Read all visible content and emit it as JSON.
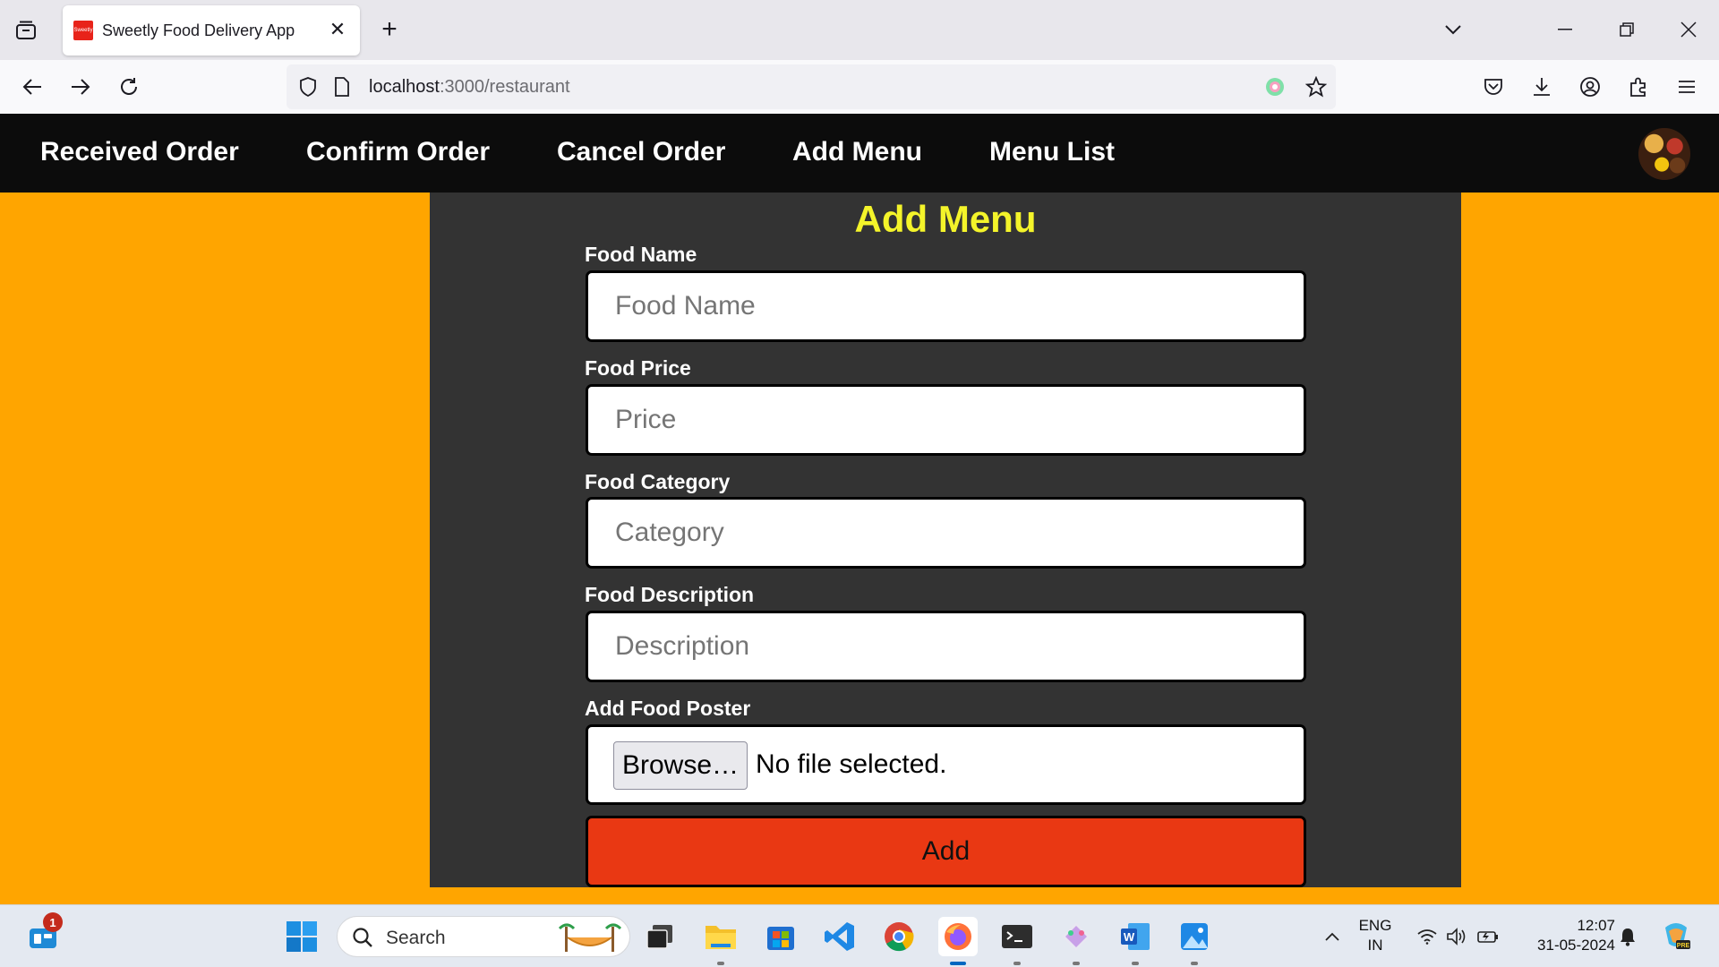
{
  "browser": {
    "tab_title": "Sweetly Food Delivery App",
    "favicon_text": "Sweetly",
    "url_host": "localhost",
    "url_path": ":3000/restaurant"
  },
  "app_nav": {
    "links": [
      "Received Order",
      "Confirm Order",
      "Cancel Order",
      "Add Menu",
      "Menu List"
    ]
  },
  "form": {
    "title": "Add Menu",
    "food_name_label": "Food Name",
    "food_name_placeholder": "Food Name",
    "price_label": "Food Price",
    "price_placeholder": "Price",
    "category_label": "Food Category",
    "category_placeholder": "Category",
    "description_label": "Food Description",
    "description_placeholder": "Description",
    "poster_label": "Add Food Poster",
    "browse_label": "Browse…",
    "file_status": "No file selected.",
    "submit_label": "Add"
  },
  "taskbar": {
    "search_placeholder": "Search",
    "widgets_badge": "1",
    "lang_line1": "ENG",
    "lang_line2": "IN",
    "time": "12:07",
    "date": "31-05-2024"
  },
  "colors": {
    "page_bg": "#ffa500",
    "panel_bg": "#333333",
    "title_color": "#f4f42a",
    "add_button": "#e93813",
    "header_bg": "#0c0c0c"
  }
}
